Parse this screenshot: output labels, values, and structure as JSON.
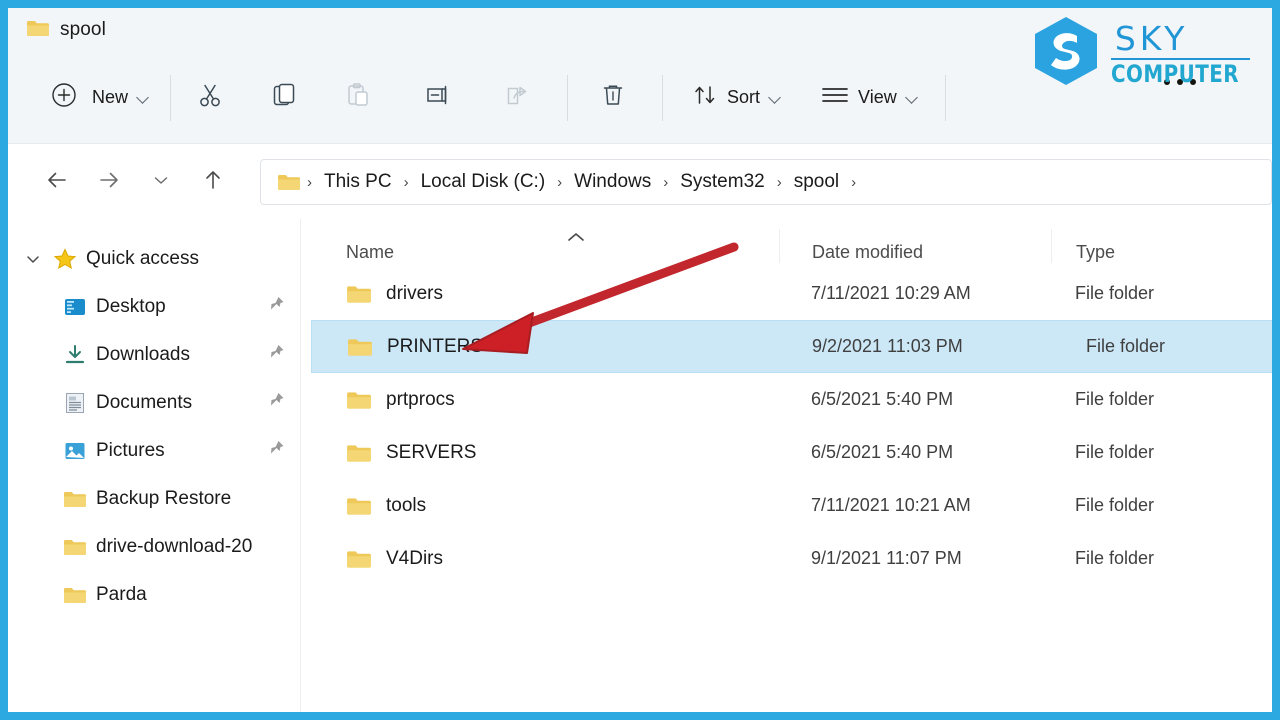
{
  "window": {
    "tab_title": "spool",
    "tab_icon": "folder-icon"
  },
  "brand": {
    "logo_icon": "sky-hexagon-s-logo",
    "line1": "SKY",
    "line2": "COMPUTER",
    "accent_primary": "#2196d6",
    "accent_secondary": "#22a7d0"
  },
  "toolbar": {
    "new_label": "New",
    "new_icon": "plus-circle-icon",
    "new_chevron_icon": "chevron-down-icon",
    "cut_icon": "scissors-icon",
    "copy_icon": "copy-icon",
    "paste_icon": "paste-icon",
    "rename_icon": "rename-icon",
    "share_icon": "share-icon",
    "delete_icon": "trash-icon",
    "sort_label": "Sort",
    "sort_icon": "sort-arrows-icon",
    "sort_chevron_icon": "chevron-down-icon",
    "view_label": "View",
    "view_icon": "hamburger-lines-icon",
    "view_chevron_icon": "chevron-down-icon"
  },
  "navbar": {
    "back_icon": "arrow-left-icon",
    "forward_icon": "arrow-right-icon",
    "recent_icon": "chevron-down-icon",
    "up_icon": "arrow-up-icon",
    "address_folder_icon": "folder-icon",
    "separator": "›",
    "breadcrumbs": [
      "This PC",
      "Local Disk (C:)",
      "Windows",
      "System32",
      "spool"
    ]
  },
  "sidebar": {
    "root": {
      "label": "Quick access",
      "icon": "star-icon",
      "expander_icon": "chevron-down-icon"
    },
    "items": [
      {
        "label": "Desktop",
        "icon": "desktop-icon",
        "pinned": true,
        "pin_icon": "pin-icon"
      },
      {
        "label": "Downloads",
        "icon": "download-icon",
        "pinned": true,
        "pin_icon": "pin-icon"
      },
      {
        "label": "Documents",
        "icon": "document-icon",
        "pinned": true,
        "pin_icon": "pin-icon"
      },
      {
        "label": "Pictures",
        "icon": "picture-icon",
        "pinned": true,
        "pin_icon": "pin-icon"
      },
      {
        "label": "Backup Restore",
        "icon": "folder-icon",
        "pinned": false,
        "pin_icon": ""
      },
      {
        "label": "drive-download-20",
        "icon": "folder-icon",
        "pinned": false,
        "pin_icon": ""
      },
      {
        "label": "Parda",
        "icon": "folder-icon",
        "pinned": false,
        "pin_icon": ""
      }
    ]
  },
  "filelist": {
    "columns": {
      "name": "Name",
      "date_modified": "Date modified",
      "type": "Type"
    },
    "sort_column": "Name",
    "sort_direction_icon": "chevron-up-icon",
    "rows": [
      {
        "name": "drivers",
        "date": "7/11/2021 10:29 AM",
        "type": "File folder",
        "icon": "folder-icon",
        "selected": false
      },
      {
        "name": "PRINTERS",
        "date": "9/2/2021 11:03 PM",
        "type": "File folder",
        "icon": "folder-icon",
        "selected": true
      },
      {
        "name": "prtprocs",
        "date": "6/5/2021 5:40 PM",
        "type": "File folder",
        "icon": "folder-icon",
        "selected": false
      },
      {
        "name": "SERVERS",
        "date": "6/5/2021 5:40 PM",
        "type": "File folder",
        "icon": "folder-icon",
        "selected": false
      },
      {
        "name": "tools",
        "date": "7/11/2021 10:21 AM",
        "type": "File folder",
        "icon": "folder-icon",
        "selected": false
      },
      {
        "name": "V4Dirs",
        "date": "9/1/2021 11:07 PM",
        "type": "File folder",
        "icon": "folder-icon",
        "selected": false
      }
    ],
    "selection_color": "#cce8f7"
  },
  "annotation": {
    "arrow_icon": "red-arrow-annotation",
    "arrow_color": "#c1272d",
    "points_to": "PRINTERS"
  },
  "frame": {
    "border_color": "#2ca9e1"
  }
}
